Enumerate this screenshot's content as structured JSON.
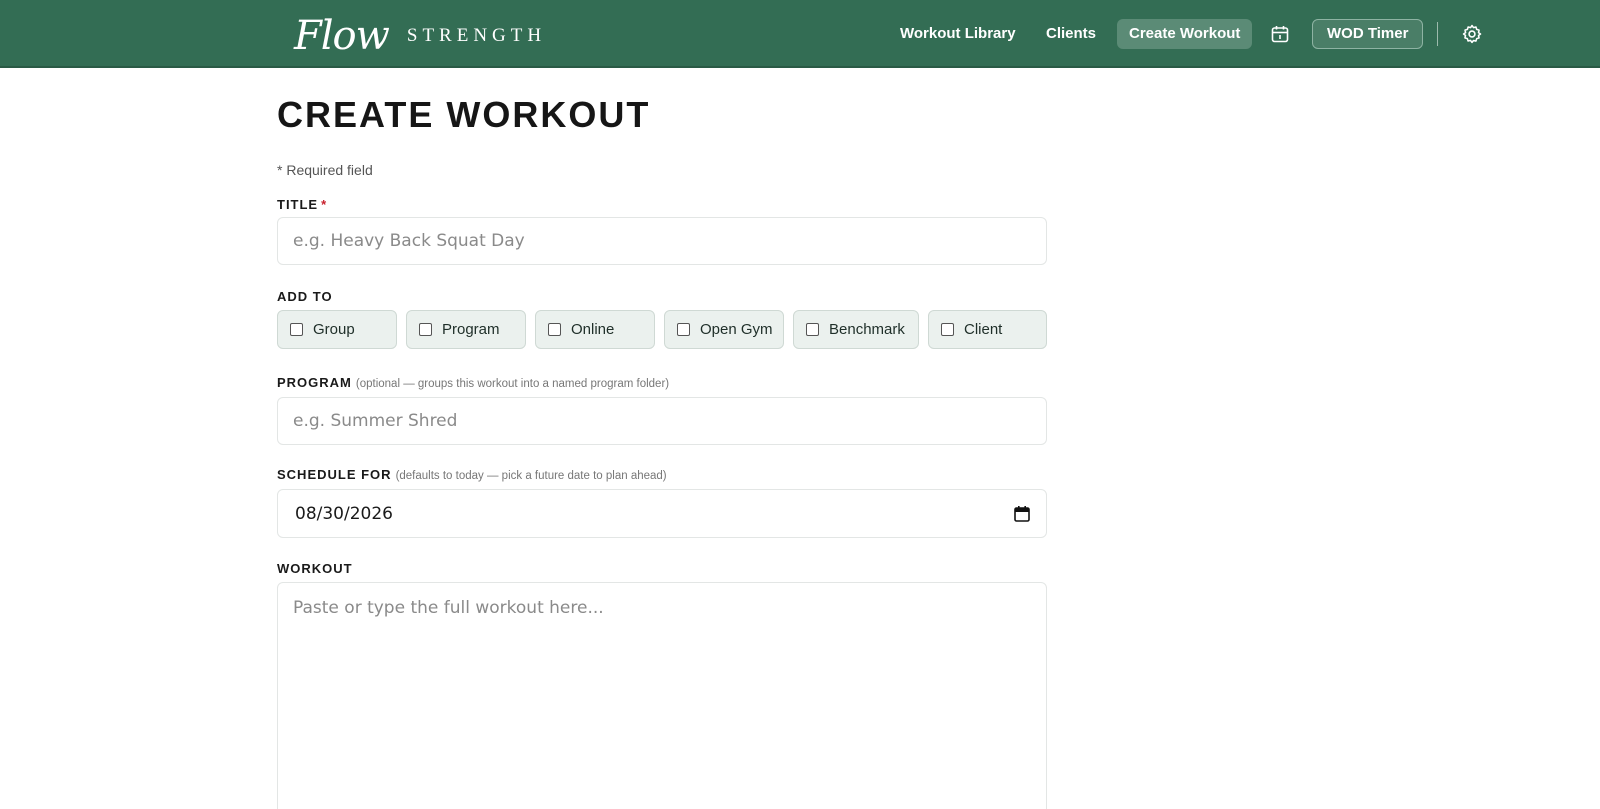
{
  "header": {
    "logo_script": "Flow",
    "logo_word": "STRENGTH",
    "nav": {
      "workout_library": "Workout Library",
      "clients": "Clients",
      "create_workout": "Create Workout",
      "wod_timer": "WOD Timer"
    },
    "icons": {
      "calendar": "calendar-icon",
      "settings": "gear-icon"
    },
    "colors": {
      "bar": "#336d54",
      "active_tab": "#5b8b76"
    }
  },
  "page": {
    "title": "CREATE WORKOUT",
    "required_note": "* Required field"
  },
  "form": {
    "title": {
      "label": "TITLE",
      "required_mark": "*",
      "placeholder": "e.g. Heavy Back Squat Day",
      "value": ""
    },
    "add_to": {
      "label": "ADD TO",
      "options": [
        "Group",
        "Program",
        "Online",
        "Open Gym",
        "Benchmark",
        "Client"
      ]
    },
    "program": {
      "label": "PROGRAM",
      "hint": "(optional — groups this workout into a named program folder)",
      "placeholder": "e.g. Summer Shred",
      "value": ""
    },
    "schedule_for": {
      "label": "SCHEDULE FOR",
      "hint": "(defaults to today — pick a future date to plan ahead)",
      "value": "08/30/2026"
    },
    "workout": {
      "label": "WORKOUT",
      "placeholder": "Paste or type the full workout here...",
      "value": ""
    }
  }
}
